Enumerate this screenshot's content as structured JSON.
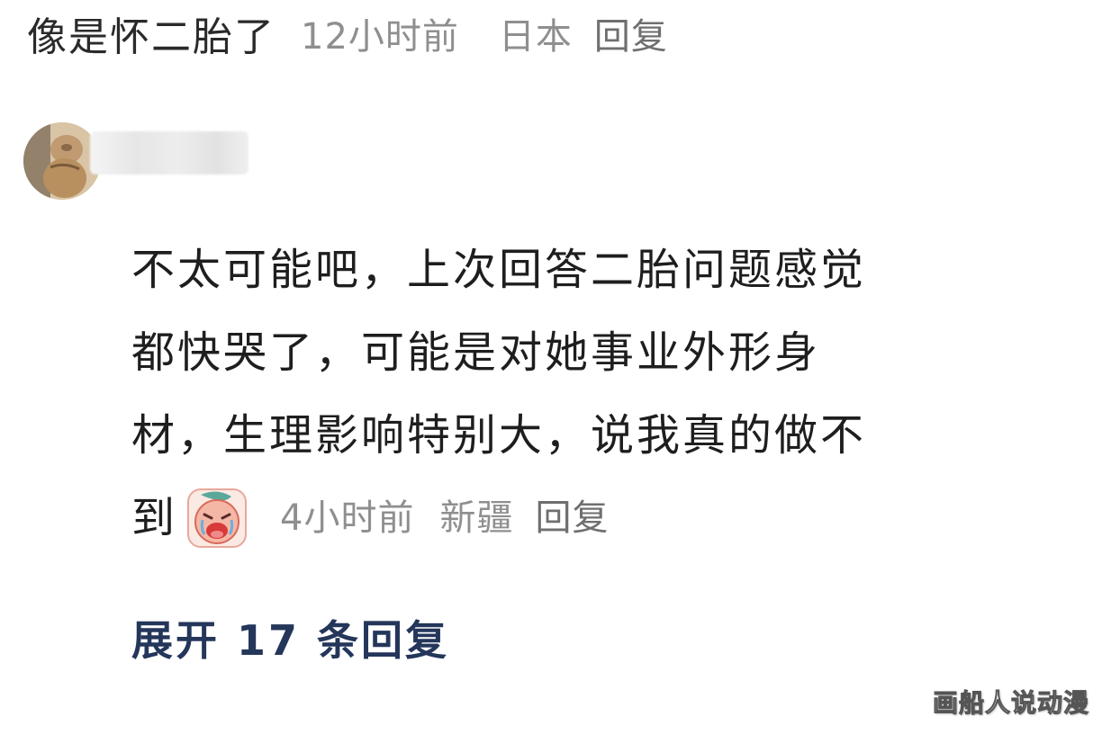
{
  "parent_comment": {
    "text": "像是怀二胎了",
    "time": "12小时前",
    "location": "日本",
    "reply_label": "回复"
  },
  "reply_comment": {
    "lines": [
      "不太可能吧，上次回答二胎问题感觉",
      "都快哭了，可能是对她事业外形身",
      "材，生理影响特别大，说我真的做不"
    ],
    "last_line_text": "到",
    "emoji": "crying-face-icon",
    "time": "4小时前",
    "location": "新疆",
    "reply_label": "回复"
  },
  "expand_replies": {
    "label": "展开 17 条回复"
  },
  "watermark": "画船人说动漫",
  "colors": {
    "text": "#1e1e1e",
    "meta": "#8f8f8f",
    "link": "#24365a",
    "background": "#ffffff"
  }
}
